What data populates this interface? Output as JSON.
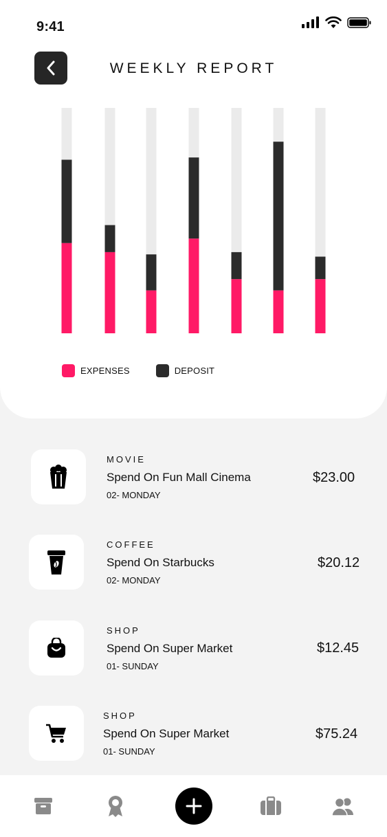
{
  "status": {
    "time": "9:41"
  },
  "header": {
    "title": "WEEKLY REPORT"
  },
  "colors": {
    "expenses": "#ff1a66",
    "deposit": "#2b2b2b",
    "track": "#ebebeb"
  },
  "chart_data": {
    "type": "bar",
    "stacked": true,
    "categories": [
      "",
      "",
      "",
      "",
      "",
      "",
      ""
    ],
    "ylim": [
      0,
      100
    ],
    "series": [
      {
        "name": "EXPENSES",
        "values": [
          40,
          36,
          19,
          42,
          24,
          19,
          24
        ]
      },
      {
        "name": "DEPOSIT",
        "values": [
          37,
          12,
          16,
          36,
          12,
          66,
          10
        ]
      }
    ],
    "legend": "bottom-left",
    "grid": false
  },
  "transactions": [
    {
      "category": "MOVIE",
      "title": "Spend On Fun Mall Cinema",
      "date": "02- MONDAY",
      "amount": "$23.00",
      "icon": "popcorn-icon"
    },
    {
      "category": "COFFEE",
      "title": "Spend On Starbucks",
      "date": "02- MONDAY",
      "amount": "$20.12",
      "icon": "coffee-cup-icon"
    },
    {
      "category": "SHOP",
      "title": "Spend On Super Market",
      "date": "01- SUNDAY",
      "amount": "$12.45",
      "icon": "shopping-bag-icon"
    },
    {
      "category": "SHOP",
      "title": "Spend On Super Market",
      "date": "01- SUNDAY",
      "amount": "$75.24",
      "icon": "cart-icon"
    }
  ],
  "tabbar": {
    "items": [
      "archive-icon",
      "award-icon",
      "add-icon",
      "briefcase-icon",
      "users-icon"
    ]
  }
}
